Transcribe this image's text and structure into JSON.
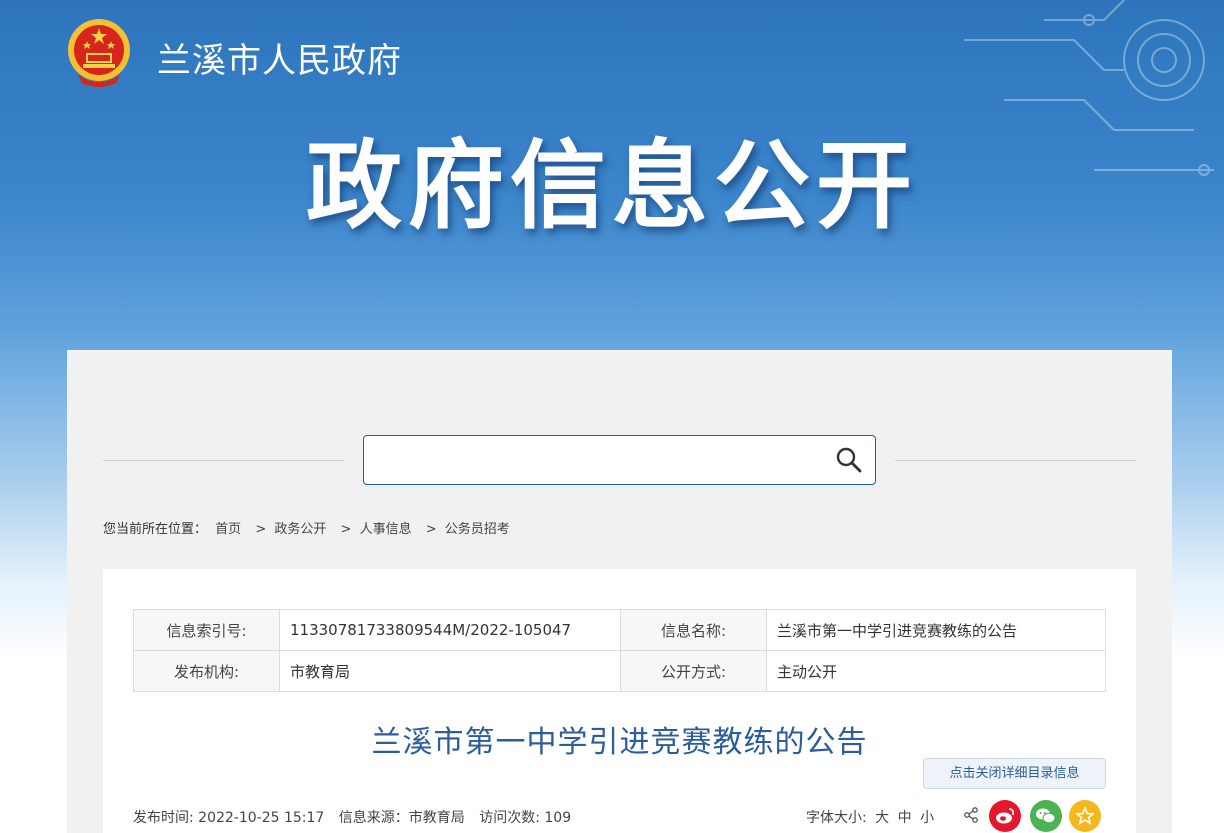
{
  "header": {
    "site_name": "兰溪市人民政府",
    "hero_title": "政府信息公开"
  },
  "search": {
    "value": "",
    "placeholder": ""
  },
  "breadcrumb": {
    "prefix": "您当前所在位置：",
    "items": [
      "首页",
      "政务公开",
      "人事信息",
      "公务员招考"
    ]
  },
  "meta": {
    "index_label": "信息索引号:",
    "index_value": "11330781733809544M/2022-105047",
    "name_label": "信息名称:",
    "name_value": "兰溪市第一中学引进竞赛教练的公告",
    "org_label": "发布机构:",
    "org_value": "市教育局",
    "mode_label": "公开方式:",
    "mode_value": "主动公开"
  },
  "document": {
    "title": "兰溪市第一中学引进竞赛教练的公告",
    "toggle_label": "点击关闭详细目录信息",
    "publish_time": "发布时间:  2022-10-25 15:17",
    "source": "信息来源：市教育局",
    "visits": "访问次数: 109"
  },
  "font_size": {
    "label": "字体大小:",
    "large": "大",
    "medium": "中",
    "small": "小"
  },
  "colors": {
    "banner_blue": "#2d74bd",
    "title_blue": "#2b5d9c",
    "weibo_red": "#e6162d",
    "wechat_green": "#4bb34f",
    "favorite_yellow": "#f5b71b"
  },
  "icons": [
    "national-emblem-icon",
    "search-icon",
    "share-icon",
    "weibo-icon",
    "wechat-icon",
    "favorite-icon"
  ]
}
